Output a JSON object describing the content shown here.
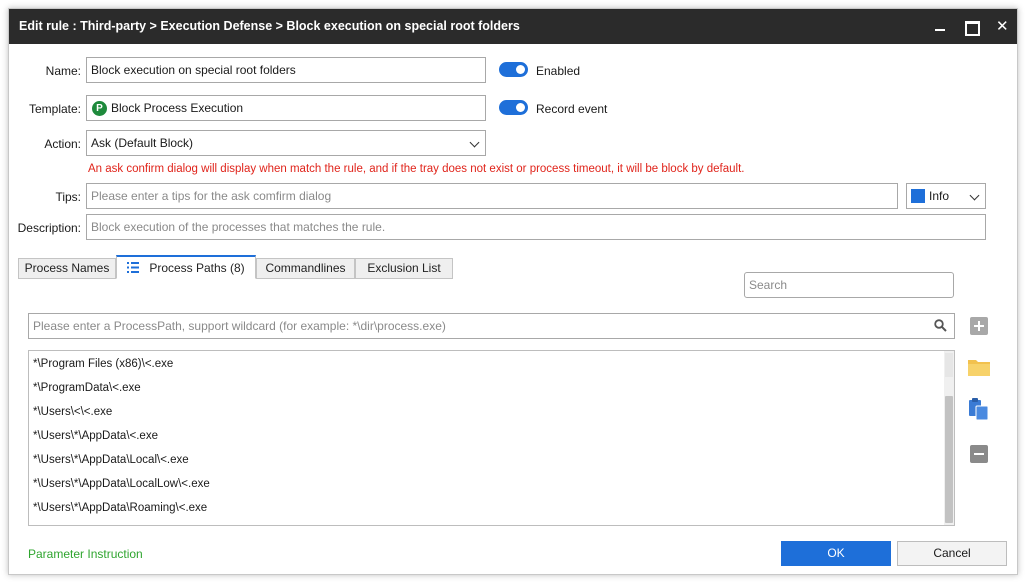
{
  "window": {
    "title": "Edit rule : Third-party > Execution Defense > Block execution on special root folders"
  },
  "form": {
    "name_label": "Name:",
    "name_value": "Block execution on special root folders",
    "enabled_label": "Enabled",
    "enabled": true,
    "template_label": "Template:",
    "template_badge": "P",
    "template_value": "Block Process Execution",
    "record_event_label": "Record event",
    "record_event": true,
    "action_label": "Action:",
    "action_value": "Ask (Default Block)",
    "action_warning": "An ask confirm dialog will display when match the rule, and if the tray does not exist or process timeout, it will be block by default.",
    "tips_label": "Tips:",
    "tips_placeholder": "Please enter a tips for the ask comfirm dialog",
    "tips_level": "Info",
    "tips_level_color": "#1e6fd9",
    "description_label": "Description:",
    "description_placeholder": "Block execution of the processes that matches the rule."
  },
  "tabs": [
    {
      "label": "Process Names"
    },
    {
      "label": "Process Paths (8)",
      "active": true
    },
    {
      "label": "Commandlines"
    },
    {
      "label": "Exclusion List"
    }
  ],
  "paths_panel": {
    "search_placeholder": "Search",
    "input_placeholder": "Please enter a ProcessPath, support wildcard (for example: *\\dir\\process.exe)",
    "items": [
      "*\\Program Files (x86)\\<.exe",
      "*\\ProgramData\\<.exe",
      "*\\Users\\<\\<.exe",
      "*\\Users\\*\\AppData\\<.exe",
      "*\\Users\\*\\AppData\\Local\\<.exe",
      "*\\Users\\*\\AppData\\LocalLow\\<.exe",
      "*\\Users\\*\\AppData\\Roaming\\<.exe"
    ]
  },
  "footer": {
    "parameter_link": "Parameter Instruction",
    "ok_label": "OK",
    "cancel_label": "Cancel"
  },
  "colors": {
    "accent": "#1e6fd9",
    "warning": "#e0241b",
    "link": "#2fa52f",
    "titlebar": "#2b2b2b"
  }
}
